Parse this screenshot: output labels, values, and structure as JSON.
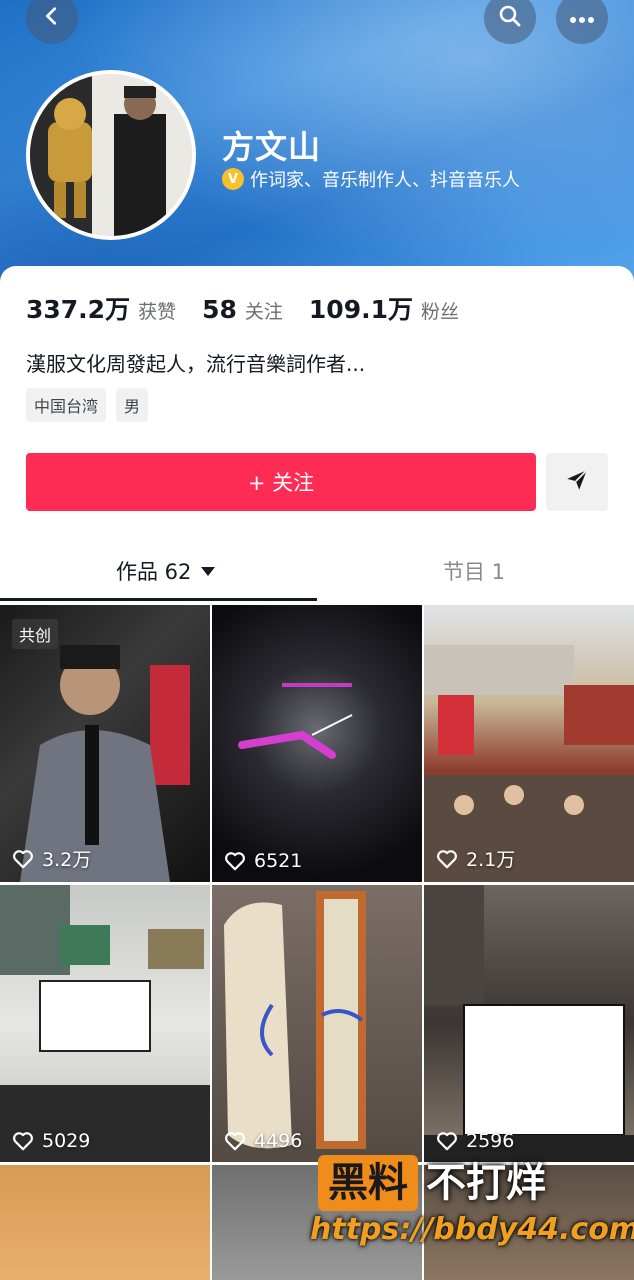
{
  "profile": {
    "name": "方文山",
    "verify_badge": "V",
    "verify_text": "作词家、音乐制作人、抖音音乐人",
    "stats": [
      {
        "num": "337.2万",
        "label": "获赞"
      },
      {
        "num": "58",
        "label": "关注"
      },
      {
        "num": "109.1万",
        "label": "粉丝"
      }
    ],
    "bio": "漢服文化周發起人，流行音樂詞作者...",
    "tags": [
      "中国台湾",
      "男"
    ],
    "follow_label": "+ 关注"
  },
  "tabs": {
    "works": "作品 62",
    "programs": "节目 1"
  },
  "tiles": [
    {
      "likes": "3.2万",
      "badge": "共创"
    },
    {
      "likes": "6521"
    },
    {
      "likes": "2.1万"
    },
    {
      "likes": "5029"
    },
    {
      "likes": "4496"
    },
    {
      "likes": "2596"
    }
  ],
  "watermark": {
    "box": "黑料",
    "text": "不打烊",
    "url": "https://bbdy44.com"
  },
  "colors": {
    "accent": "#fe2c55",
    "banner": "#2a7fd6"
  }
}
